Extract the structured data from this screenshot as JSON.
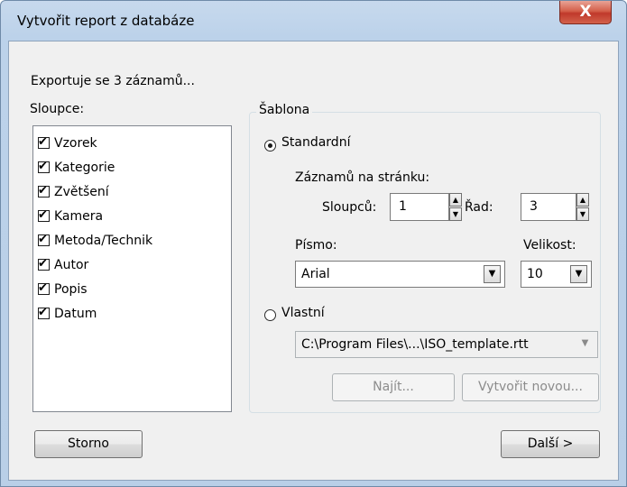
{
  "window": {
    "title": "Vytvořit report z databáze",
    "close_label": "X"
  },
  "info": "Exportuje se 3 záznamů...",
  "columns": {
    "label": "Sloupce:",
    "items": [
      {
        "label": "Vzorek",
        "checked": true
      },
      {
        "label": "Kategorie",
        "checked": true
      },
      {
        "label": "Zvětšení",
        "checked": true
      },
      {
        "label": "Kamera",
        "checked": true
      },
      {
        "label": "Metoda/Technik",
        "checked": true
      },
      {
        "label": "Autor",
        "checked": true
      },
      {
        "label": "Popis",
        "checked": true
      },
      {
        "label": "Datum",
        "checked": true
      }
    ]
  },
  "template": {
    "group_label": "Šablona",
    "standard": {
      "label": "Standardní",
      "selected": true,
      "records_per_page_label": "Záznamů na stránku:",
      "columns_label": "Sloupců:",
      "columns_value": "1",
      "rows_label": "Řad:",
      "rows_value": "3",
      "font_label": "Písmo:",
      "font_value": "Arial",
      "size_label": "Velikost:",
      "size_value": "10"
    },
    "custom": {
      "label": "Vlastní",
      "selected": false,
      "path_value": "C:\\Program Files\\...\\ISO_template.rtt",
      "find_label": "Najít...",
      "create_label": "Vytvořit novou..."
    }
  },
  "footer": {
    "cancel_label": "Storno",
    "next_label": "Další >"
  },
  "icons": {
    "check": "✔",
    "spin_up": "▲",
    "spin_down": "▼",
    "dropdown": "▼"
  }
}
